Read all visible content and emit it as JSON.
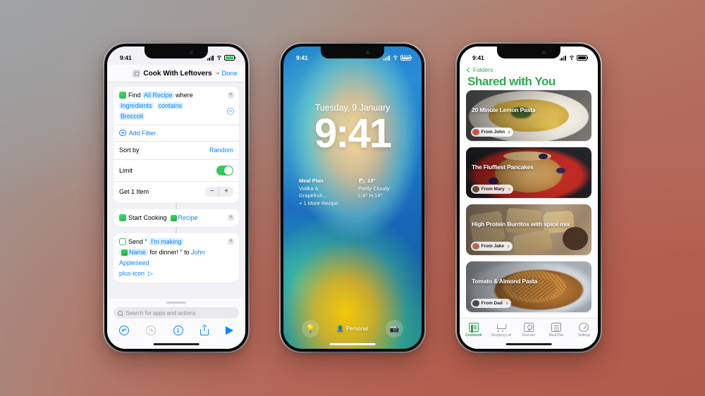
{
  "background": {
    "gradient_from": "#9a9b9e",
    "gradient_to": "#b05a4b"
  },
  "phone1": {
    "name": "Shortcuts editor",
    "status": {
      "time": "9:41",
      "battery_icon": "battery-charging-icon",
      "wifi_icon": "wifi-icon",
      "cellular_icon": "cellular-bars-icon"
    },
    "nav": {
      "title": "Cook With Leftovers",
      "app_icon": "shortcut-app-icon",
      "chevron": "chevron-down-icon",
      "done_label": "Done"
    },
    "actions": {
      "find": {
        "icon": "recipes-app-icon",
        "verb": "Find",
        "target": "All Recipe",
        "where": "where",
        "filter_field": "Ingredients",
        "filter_op": "contains",
        "filter_value": "Broccoli",
        "remove_icon": "close-circle-icon",
        "minus_icon": "minus-circle-icon",
        "add_filter_label": "Add Filter",
        "add_filter_icon": "plus-circle-icon",
        "sort_label": "Sort by",
        "sort_value": "Random",
        "limit_label": "Limit",
        "limit_on": true,
        "get_label": "Get 1 Item",
        "minus_label": "−",
        "plus_label": "+"
      },
      "start_cooking": {
        "icon": "recipes-app-icon",
        "label": "Start Cooking",
        "param_icon": "recipe-variable-icon",
        "param": "Recipe",
        "remove_icon": "close-circle-icon"
      },
      "send": {
        "icon": "messages-app-icon",
        "label": "Send",
        "quote_open": "“",
        "text_part1": "I'm making",
        "var_icon": "recipe-variable-icon",
        "var_name": "Name",
        "text_part2": "for dinner!",
        "quote_close": "”",
        "to_label": "to",
        "recipient": "John Appleseed",
        "add_icon": "plus-icon",
        "more_icon": "chevron-right-circle-icon",
        "remove_icon": "close-circle-icon"
      }
    },
    "search": {
      "placeholder": "Search for apps and actions",
      "icon": "search-icon"
    },
    "toolbar": [
      {
        "name": "undo-button",
        "icon": "undo-arrow-icon"
      },
      {
        "name": "redo-button",
        "icon": "redo-arrow-icon"
      },
      {
        "name": "info-button",
        "icon": "info-circle-icon"
      },
      {
        "name": "share-button",
        "icon": "share-icon"
      },
      {
        "name": "run-button",
        "icon": "play-icon"
      }
    ]
  },
  "phone2": {
    "name": "Lock screen",
    "status": {
      "time": "9:41",
      "battery_percent": "100",
      "battery_icon": "battery-full-icon",
      "wifi_icon": "wifi-icon",
      "cellular_icon": "cellular-bars-icon"
    },
    "date": "Tuesday, 9 January",
    "time": "9:41",
    "widgets": [
      {
        "name": "meal-plan-widget",
        "title": "Meal Plan",
        "line1": "Vodka & Grapefruit...",
        "line2": "+ 1 More Recipe"
      },
      {
        "name": "weather-widget",
        "icon": "partly-cloudy-icon",
        "temp": "10°",
        "condition": "Partly Cloudy",
        "range": "L:4° H:14°"
      }
    ],
    "bottom": {
      "flashlight_icon": "flashlight-icon",
      "camera_icon": "camera-icon",
      "focus_icon": "person-icon",
      "focus_label": "Personal"
    }
  },
  "phone3": {
    "name": "Shared with You",
    "status": {
      "time": "9:41",
      "battery_icon": "battery-full-icon",
      "wifi_icon": "wifi-icon",
      "cellular_icon": "cellular-bars-icon"
    },
    "back_label": "Folders",
    "back_icon": "chevron-left-icon",
    "title": "Shared with You",
    "accent_color": "#2fa84f",
    "recipes": [
      {
        "title": "20 Minute Lemon Pasta",
        "from": "From John",
        "avatar_color": "#c4564a"
      },
      {
        "title": "The Fluffiest Pancakes",
        "from": "From Mary",
        "avatar_color": "#6b4a33"
      },
      {
        "title": "High Protein Burritos with spice mix",
        "from": "From Jake",
        "avatar_color": "#b06a4a"
      },
      {
        "title": "Tomato & Almond Pasta",
        "from": "From Dad",
        "avatar_color": "#4a4a4a"
      }
    ],
    "tabs": [
      {
        "label": "Cookbook",
        "icon": "book-icon",
        "active": true
      },
      {
        "label": "Shopping List",
        "icon": "cart-icon",
        "active": false
      },
      {
        "label": "Discover",
        "icon": "phone-discover-icon",
        "active": false
      },
      {
        "label": "Meal Plan",
        "icon": "document-icon",
        "active": false
      },
      {
        "label": "Settings",
        "icon": "gear-icon",
        "active": false
      }
    ]
  }
}
